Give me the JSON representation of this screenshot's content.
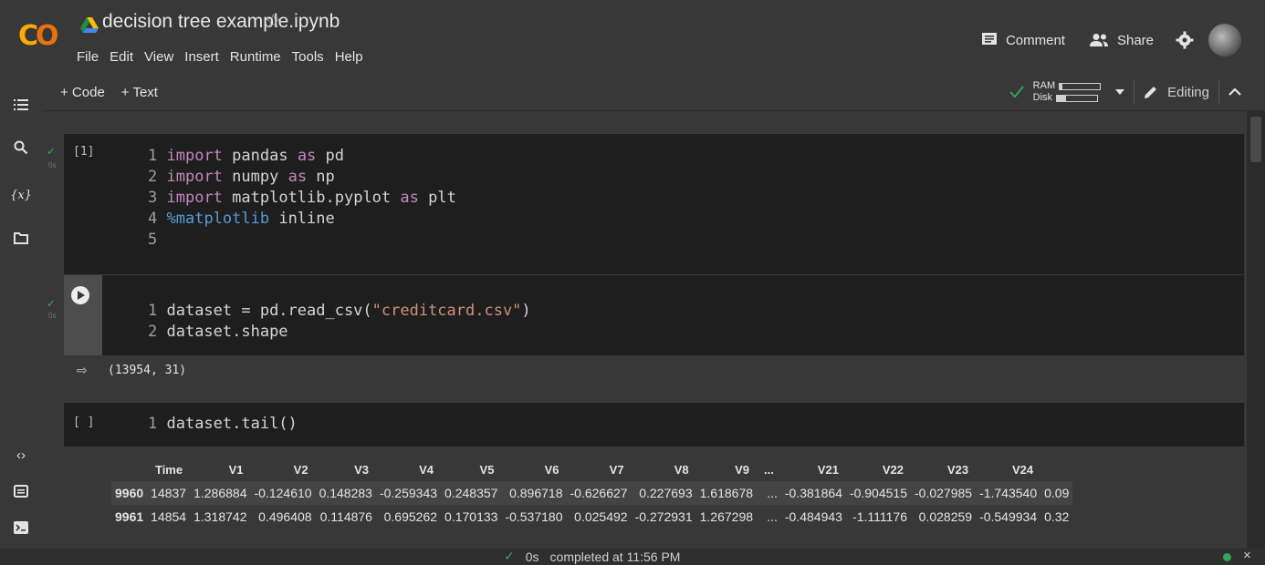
{
  "header": {
    "logo": "CO",
    "title": "decision tree example.ipynb",
    "menu": [
      "File",
      "Edit",
      "View",
      "Insert",
      "Runtime",
      "Tools",
      "Help"
    ],
    "comment_label": "Comment",
    "share_label": "Share"
  },
  "toolbar": {
    "add_code": "+ Code",
    "add_text": "+ Text",
    "ram_label": "RAM",
    "disk_label": "Disk",
    "ram_level": 0.06,
    "disk_level": 0.22,
    "editing_label": "Editing"
  },
  "cells": [
    {
      "exec": "[1]",
      "time": "0s",
      "lines": [
        "1",
        "2",
        "3",
        "4",
        "5"
      ]
    },
    {
      "time": "0s",
      "output": "(13954, 31)"
    },
    {
      "exec": "[ ]"
    }
  ],
  "table": {
    "columns": [
      "",
      "Time",
      "V1",
      "V2",
      "V3",
      "V4",
      "V5",
      "V6",
      "V7",
      "V8",
      "V9",
      "...",
      "V21",
      "V22",
      "V23",
      "V24"
    ],
    "rows": [
      [
        "9960",
        "14837",
        "1.286884",
        "-0.124610",
        "0.148283",
        "-0.259343",
        "0.248357",
        "0.896718",
        "-0.626627",
        "0.227693",
        "1.618678",
        "...",
        "-0.381864",
        "-0.904515",
        "-0.027985",
        "-1.743540",
        "0.09"
      ],
      [
        "9961",
        "14854",
        "1.318742",
        "0.496408",
        "0.114876",
        "0.695262",
        "0.170133",
        "-0.537180",
        "0.025492",
        "-0.272931",
        "1.267298",
        "...",
        "-0.484943",
        "-1.111176",
        "0.028259",
        "-0.549934",
        "0.32"
      ]
    ]
  },
  "status": {
    "check": "✓",
    "time": "0s",
    "message": "completed at 11:56 PM"
  }
}
